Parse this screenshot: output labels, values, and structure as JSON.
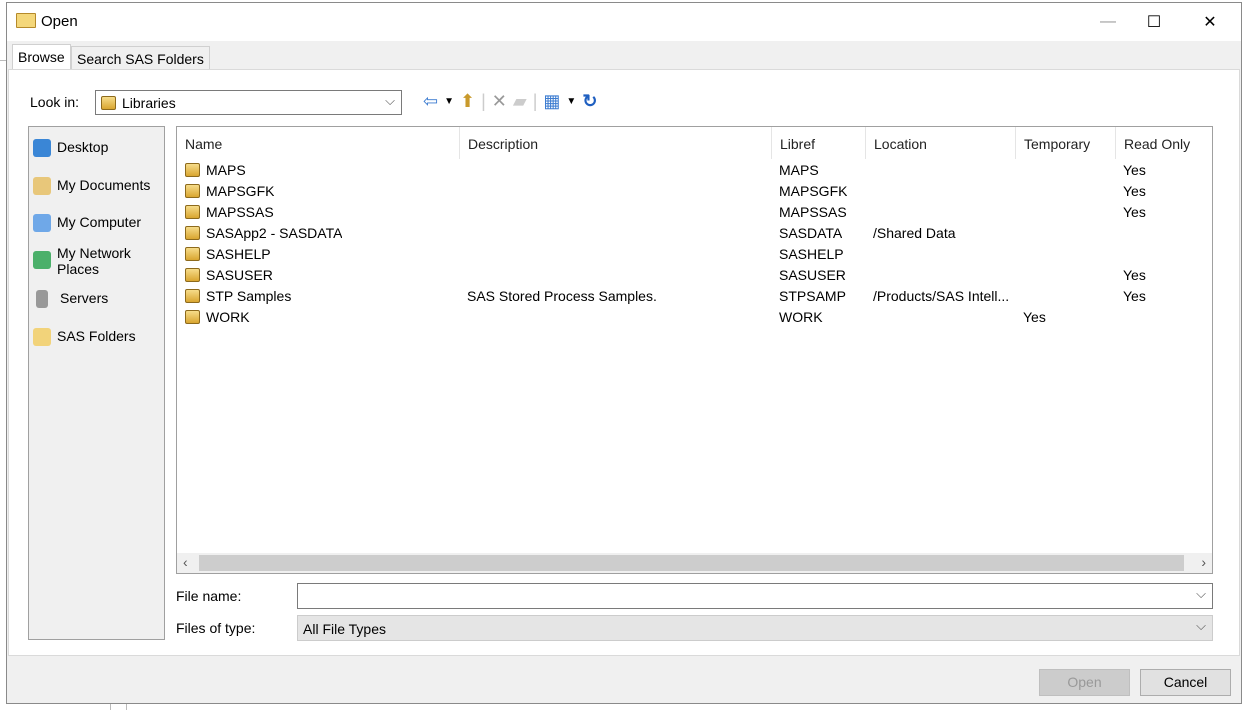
{
  "window": {
    "title": "Open",
    "minimize": "—",
    "maximize": "☐",
    "close": "✕"
  },
  "tabs": [
    {
      "label": "Browse"
    },
    {
      "label": "Search SAS Folders"
    }
  ],
  "look_in": {
    "label": "Look in:",
    "value": "Libraries"
  },
  "sidebar": {
    "items": [
      {
        "label": "Desktop"
      },
      {
        "label": "My Documents"
      },
      {
        "label": "My Computer"
      },
      {
        "label": "My Network Places"
      },
      {
        "label": "Servers"
      },
      {
        "label": "SAS Folders"
      }
    ]
  },
  "columns": [
    "Name",
    "Description",
    "Libref",
    "Location",
    "Temporary",
    "Read Only"
  ],
  "rows": [
    {
      "name": "MAPS",
      "description": "",
      "libref": "MAPS",
      "location": "",
      "temporary": "",
      "readonly": "Yes"
    },
    {
      "name": "MAPSGFK",
      "description": "",
      "libref": "MAPSGFK",
      "location": "",
      "temporary": "",
      "readonly": "Yes"
    },
    {
      "name": "MAPSSAS",
      "description": "",
      "libref": "MAPSSAS",
      "location": "",
      "temporary": "",
      "readonly": "Yes"
    },
    {
      "name": "SASApp2 - SASDATA",
      "description": "",
      "libref": "SASDATA",
      "location": "/Shared Data",
      "temporary": "",
      "readonly": ""
    },
    {
      "name": "SASHELP",
      "description": "",
      "libref": "SASHELP",
      "location": "",
      "temporary": "",
      "readonly": ""
    },
    {
      "name": "SASUSER",
      "description": "",
      "libref": "SASUSER",
      "location": "",
      "temporary": "",
      "readonly": "Yes"
    },
    {
      "name": "STP Samples",
      "description": "SAS Stored Process Samples.",
      "libref": "STPSAMP",
      "location": "/Products/SAS Intell...",
      "temporary": "",
      "readonly": "Yes"
    },
    {
      "name": "WORK",
      "description": "",
      "libref": "WORK",
      "location": "",
      "temporary": "Yes",
      "readonly": ""
    }
  ],
  "file_name": {
    "label": "File name:",
    "value": ""
  },
  "file_type": {
    "label": "Files of type:",
    "value": "All File Types"
  },
  "buttons": {
    "open": "Open",
    "cancel": "Cancel"
  }
}
